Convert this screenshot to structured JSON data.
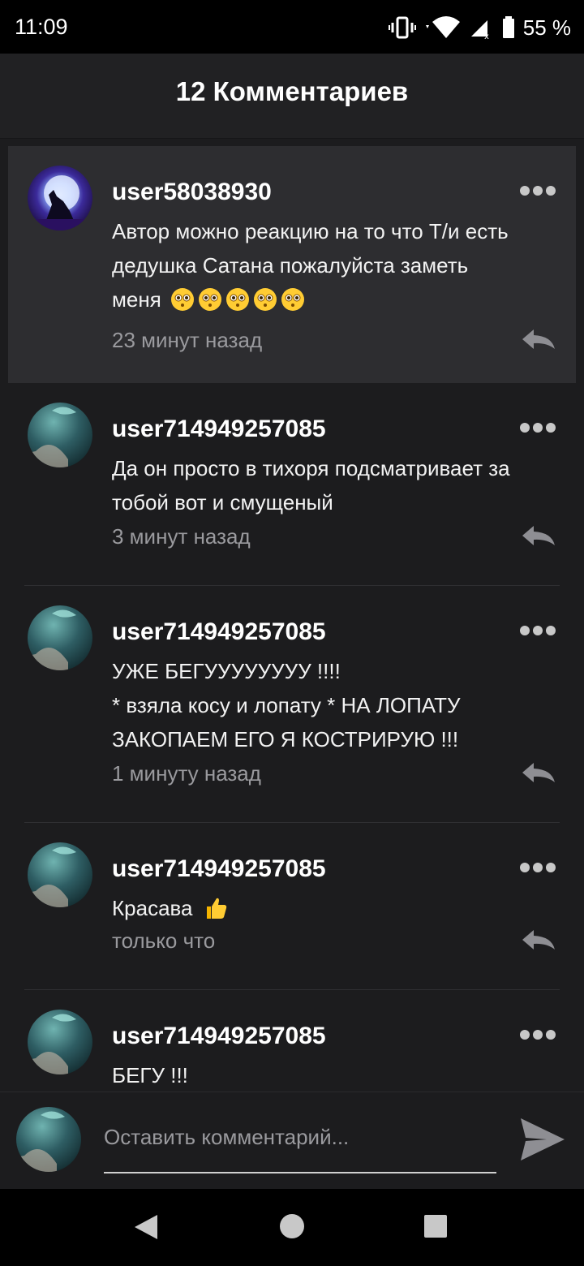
{
  "status_bar": {
    "time": "11:09",
    "battery_text": "55 %"
  },
  "header": {
    "title": "12 Комментариев"
  },
  "comments": [
    {
      "username": "user58038930",
      "text_lines": [
        "Автор можно реакцию на то что Т/и есть",
        "дедушка Сатана пожалуйста заметь",
        "меня"
      ],
      "emojis": [
        "flushed-face",
        "flushed-face",
        "flushed-face",
        "flushed-face",
        "flushed-face"
      ],
      "time": "23 минут назад",
      "avatar": "wolf-moon-avatar",
      "highlighted": true
    },
    {
      "username": "user714949257085",
      "text_lines": [
        "Да он просто в тихоря подсматривает за",
        "тобой вот и смущеный"
      ],
      "time": "3 минут назад",
      "avatar": "teal-portrait-avatar"
    },
    {
      "username": "user714949257085",
      "text_lines": [
        "УЖЕ БЕГУУУУУУУУ !!!!",
        "* взяла косу и лопату * НА ЛОПАТУ",
        "ЗАКОПАЕМ ЕГО Я КОСТРИРУЮ !!!"
      ],
      "time": "1 минуту назад",
      "avatar": "teal-portrait-avatar"
    },
    {
      "username": "user714949257085",
      "text_lines": [
        "Красава"
      ],
      "emojis": [
        "thumbs-up"
      ],
      "time": "только что",
      "avatar": "teal-portrait-avatar"
    },
    {
      "username": "user714949257085",
      "text_lines": [
        "БЕГУ !!!"
      ],
      "time": "",
      "avatar": "teal-portrait-avatar"
    }
  ],
  "composer": {
    "placeholder": "Оставить комментарий..."
  },
  "icons": {
    "more": "more-dots-icon",
    "reply": "reply-arrow-icon",
    "send": "send-icon",
    "nav_back": "nav-back-icon",
    "nav_home": "nav-home-icon",
    "nav_recents": "nav-recents-icon"
  },
  "colors": {
    "background": "#1c1c1e",
    "highlight": "#2d2d30",
    "secondary_text": "#9a9a9e"
  }
}
